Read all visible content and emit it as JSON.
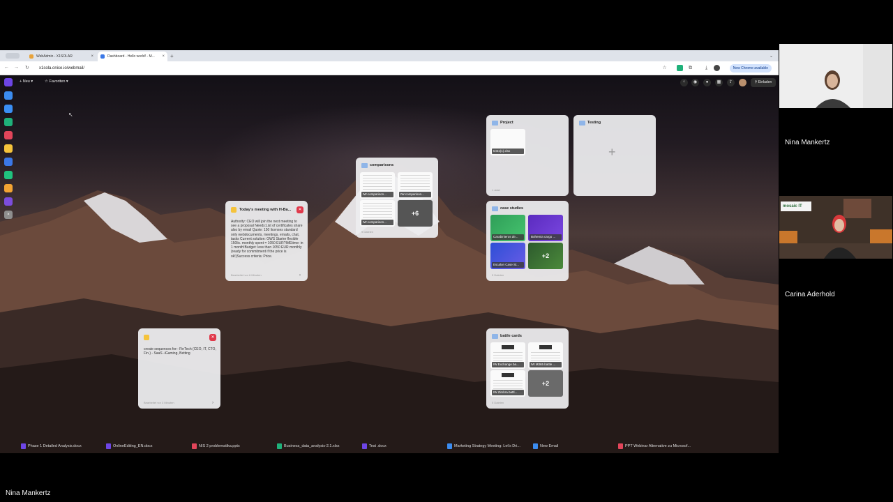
{
  "tabs": [
    {
      "label": "WebAdmin - X1SOLAR",
      "color": "#e8a33a"
    },
    {
      "label": "Dashboard - Hello world! - M...",
      "color": "#3b78e7"
    }
  ],
  "address": {
    "url": "x1sola.onice.io/webmail/"
  },
  "chrome_available": "New Chrome available",
  "app": {
    "new_label": "+ Neu ▾",
    "favorites_label": "☆ Favoriten ▾",
    "invite_label": "Einladen"
  },
  "dock_colors": [
    "#6d45e5",
    "#3b8cf0",
    "#3a8ff5",
    "#1fb17a",
    "#e2455a",
    "#f5c33b",
    "#3b78e7",
    "#20c27e",
    "#f3a433",
    "#7c4ddc",
    "#8e8e8e"
  ],
  "widgets": {
    "comparisons": {
      "title": "comparisons",
      "items": [
        "IW-comparison...",
        "IW-comparison...",
        "IW-comparison..."
      ],
      "more": "+6",
      "footer": "9 Dateien"
    },
    "project": {
      "title": "Project",
      "items": [
        "test1(1).xlsx"
      ],
      "footer": "1 datei"
    },
    "testing": {
      "title": "Testing",
      "plus": "+"
    },
    "case_studies": {
      "title": "case studies",
      "items": [
        "Carabinieros de...",
        "Bohemia cargo ...",
        "Escalon Case St..."
      ],
      "more": "+2",
      "footer": "5 Dateien"
    },
    "battle_cards": {
      "title": "battle cards",
      "items": [
        "IW Exchange ba...",
        "IW M365 battle ...",
        "IW Zimbra battl..."
      ],
      "more": "+2",
      "footer": "5 Dateien"
    }
  },
  "notes": {
    "meeting": {
      "title": "Today's meeting with H-Ba...",
      "body": "Authority: CEO will join the next meeting to see a proposal Needs:List of certificates share also by email Quote: 150 licenses standard only webdocuments, meetings, emails, chat, tasks Current solution: GWS Starter flexible 150lic. monthly spent = 1050 EUR?IMEtime: in 1 month!Budget: less than 1050 EUR monthly (ready for commitment if the price is ok!)Success criteria: Price.",
      "footer": "Bearbeitet vor 6 Minuten"
    },
    "sequences": {
      "title": "",
      "body": "create sequences for:- FinTech (CEO, IT, CTO, Fin.) - SaaS -iGaming, Betting",
      "footer": "Bearbeitet vor 3 Minuten"
    }
  },
  "taskbar": [
    {
      "label": "Phase 1 Detailed Analysis.docx",
      "color": "#6d45e5"
    },
    {
      "label": "OnlineEditing_EN.docx",
      "color": "#6d45e5"
    },
    {
      "label": "NIS 2 problematika.pptx",
      "color": "#e2455a"
    },
    {
      "label": "Business_data_analysis-2.1.xlsx",
      "color": "#1fb17a"
    },
    {
      "label": "Test .docx",
      "color": "#6d45e5"
    },
    {
      "label": "Marketing Strategy Meeting: Let's Dri...",
      "color": "#3b8cf0"
    },
    {
      "label": "New Email",
      "color": "#3b8cf0"
    },
    {
      "label": "PPT Webinar Alternative zu Microsof...",
      "color": "#e2455a"
    }
  ],
  "participants": {
    "p1": "Nina Mankertz",
    "p2": "Carina Aderhold",
    "p2_banner": "mosaic IT",
    "bottom": "Nina Mankertz"
  }
}
